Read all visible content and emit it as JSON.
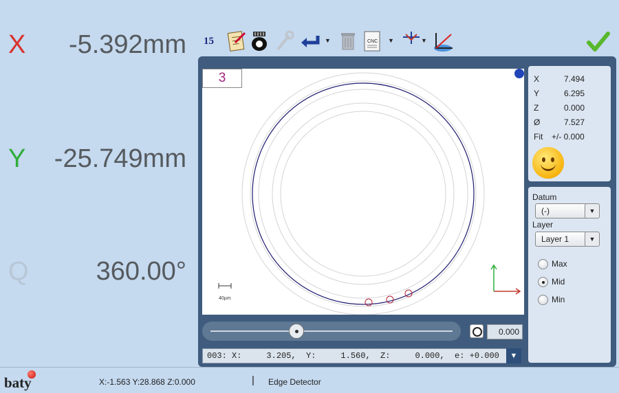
{
  "dro": {
    "x": {
      "axis": "X",
      "value": "-5.392mm"
    },
    "y": {
      "axis": "Y",
      "value": "-25.749mm"
    },
    "q": {
      "axis": "Q",
      "value": "360.00°"
    }
  },
  "toolbar": {
    "count": "15",
    "icons": [
      "report-icon",
      "probe-icon",
      "wrench-icon",
      "return-icon",
      "trash-icon",
      "cnc-icon",
      "crosshair-icon",
      "datum-icon"
    ]
  },
  "viewport": {
    "layer_tag": "3",
    "scale_label": "40µm"
  },
  "result": {
    "x_label": "X",
    "x_value": "7.494",
    "y_label": "Y",
    "y_value": "6.295",
    "z_label": "Z",
    "z_value": "0.000",
    "d_label": "Ø",
    "d_value": "7.527",
    "fit_label": "Fit",
    "fit_value": "+/- 0.000",
    "status_icon": "smiley-icon"
  },
  "options": {
    "datum_label": "Datum",
    "datum_value": "(-)",
    "layer_label": "Layer",
    "layer_value": "Layer 1",
    "radios": [
      {
        "label": "Max",
        "selected": false
      },
      {
        "label": "Mid",
        "selected": true
      },
      {
        "label": "Min",
        "selected": false
      }
    ]
  },
  "slider": {
    "value": "0.000"
  },
  "command_line": "003: X:     3.205,  Y:     1.560,  Z:     0.000,  e: +0.000",
  "status": {
    "logo": "baty",
    "coords": "X:-1.563 Y:28.868 Z:0.000",
    "separator": "|",
    "tool": "Edge Detector"
  },
  "colors": {
    "accent_panel": "#3f5c7e",
    "x_axis": "#d8322a",
    "y_axis": "#2fae3b",
    "circle": "#1d1a6e"
  }
}
